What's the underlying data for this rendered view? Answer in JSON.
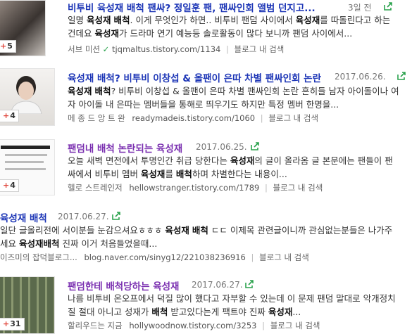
{
  "results": [
    {
      "title_pre": "비투비 ",
      "title_hl": "육성재 배척",
      "title_post": " 팬싸? 정일훈 팬, 팬싸인회 앨범 던지고...",
      "date": "3일 전",
      "desc1": "일명 육성재 배척. 이게 무엇인가 하면.. 비투비 팬덤 사이에서 육성재를 따돌린다고 하는",
      "desc2": "건데요 육성재가 드라마 연기 예능등 솔로활동이 많다 보니까 팬덤 사이에서...",
      "source": "서브 미션",
      "url": "tjqmaltus.tistory.com/1134",
      "inner_search": "블로그 내 검색",
      "badge": "5"
    },
    {
      "title_pre": "",
      "title_hl": "육성재 배척",
      "title_post": "? 비투비 이창섭 & 올팬이 은따 차별 팬싸인회 논란",
      "date": "2017.06.26.",
      "desc1": "육성재 배척? 비투비 이창섭 & 올팬이 은따 차별 팬싸인회 논란 흔히들 남자 아이돌이나 여",
      "desc2": "자 아이돌 내 은따는 멤버들을 통해로 띄우기도 하지만 특정 멤버 한명을...",
      "source": "메 종 드 앙 트 완",
      "url": "readymadeis.tistory.com/1060",
      "inner_search": "블로그 내 검색",
      "badge": "4"
    },
    {
      "title_pre": "팬덤내 ",
      "title_hl": "배척",
      "title_post": " 논란되는 ",
      "title_hl2": "육성재",
      "date": "2017.06.25.",
      "desc1": "오늘 새벽 면전에서 투명인간 취급 당한다는 육성재의 글이 올라옴 글 본문에는 팬들이 팬",
      "desc2": "싸에서 비투비 멤버 육성재를 배척하며 차별한다는 내용이...",
      "source": "헬로 스트레인저",
      "url": "hellowstranger.tistory.com/1789",
      "inner_search": "블로그 내 검색",
      "badge": "4"
    },
    {
      "title_pre": "",
      "title_hl": "육성재 배척",
      "title_post": "",
      "date": "2017.06.27.",
      "desc1": "일단 글올리전에 서이분들 눈감으셔요ㅎㅎㅎ 육성재 배척 ㄷㄷ 이제목 관련글이니까 관심없는분들은 나가주",
      "desc2": "세요 육성재배척 진짜 이거 처음들었을때...",
      "source": "이즈미의 잡덕블로그...",
      "url": "blog.naver.com/sinyg12/221038236916",
      "inner_search": "블로그 내 검색"
    },
    {
      "title_pre": "팬덤한테 ",
      "title_hl": "배척",
      "title_post": "당하는 ",
      "title_hl2": "육성재",
      "date": "2017.06.27.",
      "desc1": "나름 비투비 온오프에서 덕질 많이 했다고 자부할 수 있는데 이 문제 팬덤 말대로 악개정치",
      "desc2": "질 절대 아니고 성재가 배척 받고있다는게 팩트야 진짜 육성재...",
      "source": "할리우드는 지금",
      "url": "hollywoodnow.tistory.com/3253",
      "inner_search": "블로그 내 검색",
      "badge": "31"
    }
  ]
}
